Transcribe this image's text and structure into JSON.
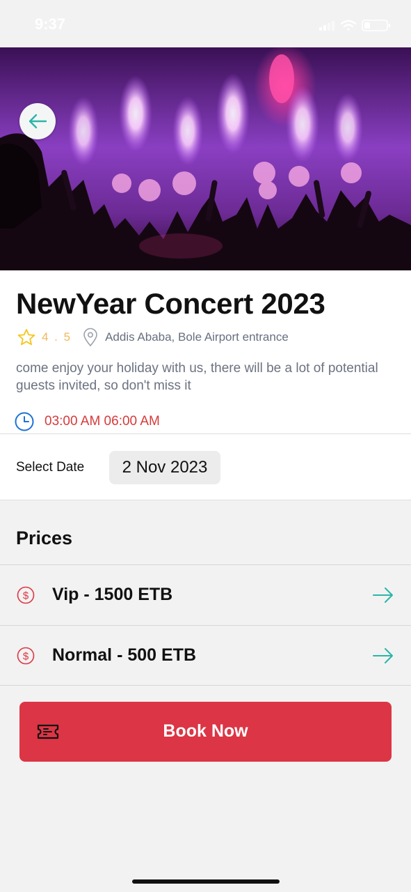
{
  "status_bar": {
    "time": "9:37"
  },
  "event": {
    "title": "NewYear Concert 2023",
    "rating": "4 . 5",
    "location": "Addis Ababa, Bole Airport entrance",
    "description": "come enjoy your holiday with us, there will be a lot of potential guests invited, so don't miss it",
    "time_range": "03:00 AM 06:00 AM"
  },
  "date_select": {
    "label": "Select Date",
    "value": "2 Nov 2023"
  },
  "prices": {
    "title": "Prices",
    "items": [
      {
        "label": "Vip - 1500 ETB"
      },
      {
        "label": "Normal - 500 ETB"
      }
    ]
  },
  "book_button": {
    "label": "Book Now"
  },
  "colors": {
    "accent_red": "#dc3545",
    "accent_teal": "#2bb5a9",
    "rating_star": "#f5c518"
  }
}
